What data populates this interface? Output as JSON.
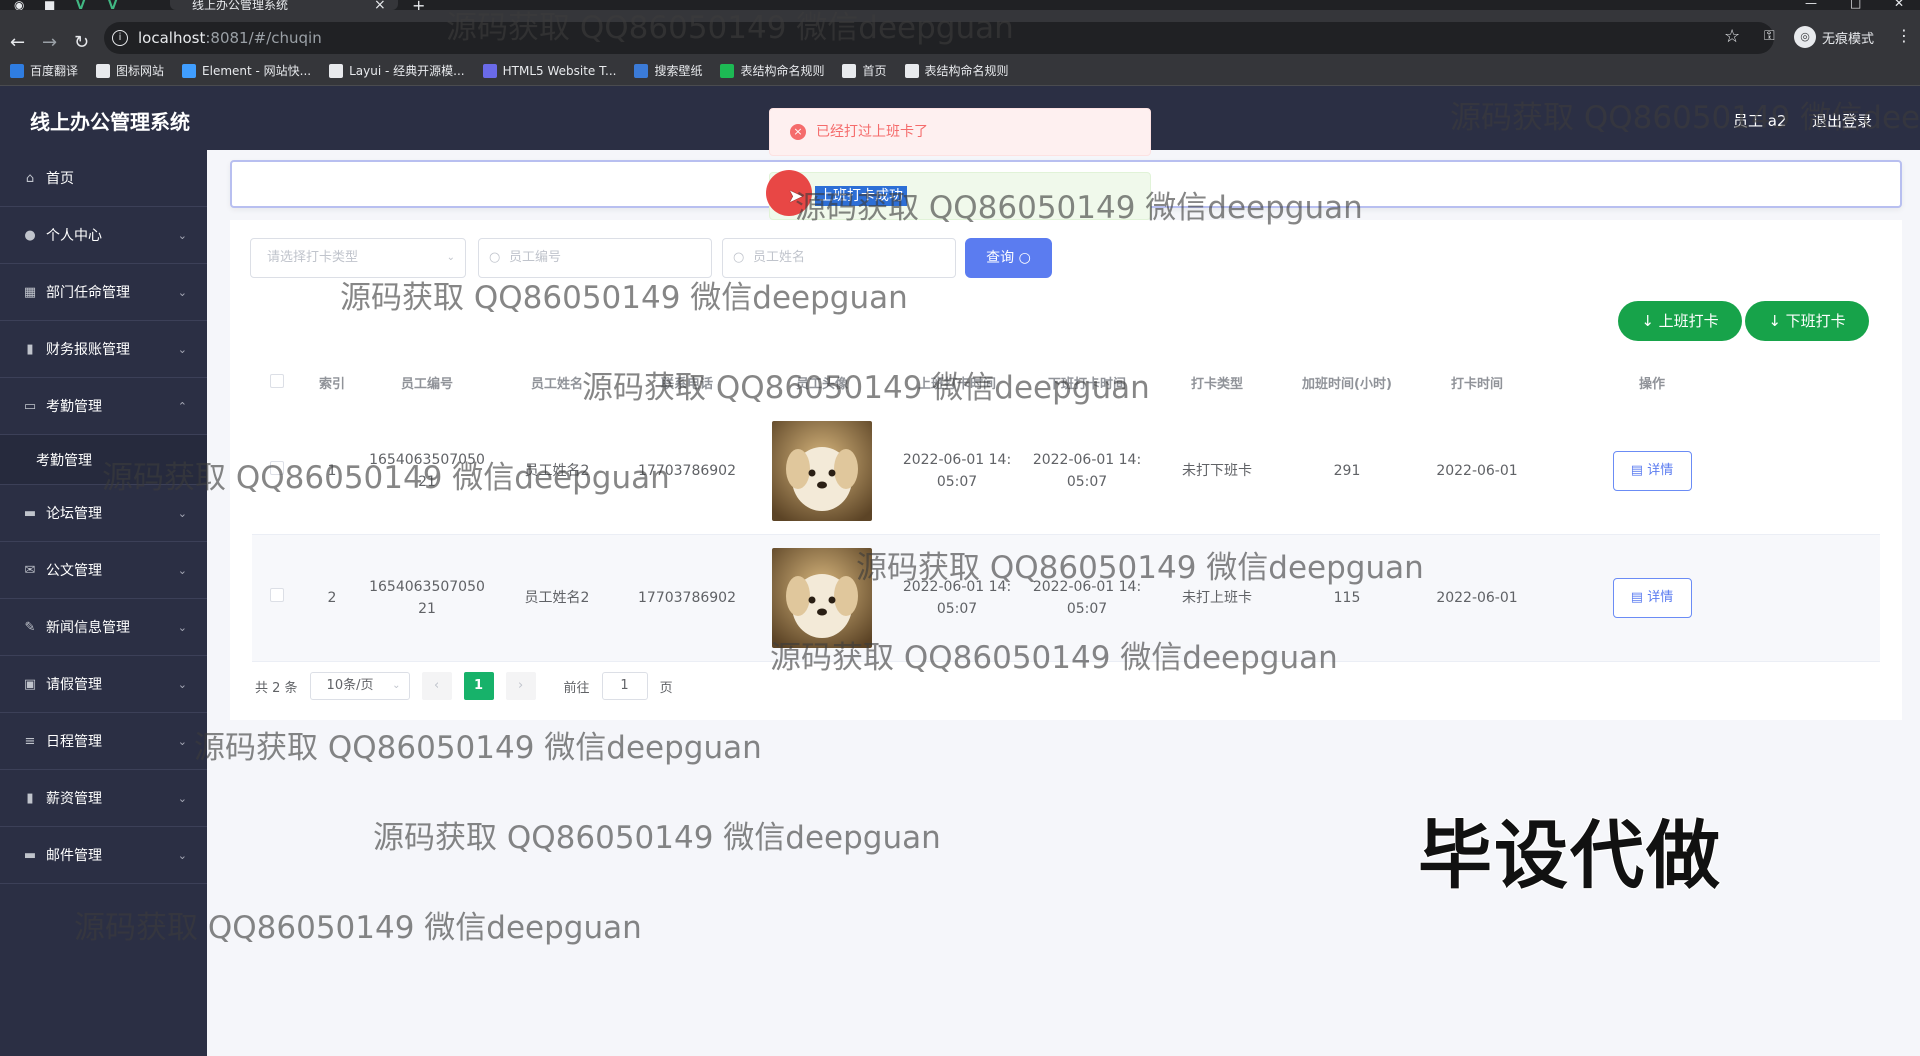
{
  "browser": {
    "tab_title": "线上办公管理系统",
    "url_host": "localhost",
    "url_path": ":8081/#/chuqin",
    "incognito_label": "无痕模式",
    "bookmarks": [
      {
        "label": "百度翻译",
        "color": "#2f7de1"
      },
      {
        "label": "图标网站",
        "color": "#e8eaed"
      },
      {
        "label": "Element - 网站快...",
        "color": "#409eff"
      },
      {
        "label": "Layui - 经典开源模...",
        "color": "#e8eaed"
      },
      {
        "label": "HTML5 Website T...",
        "color": "#6a6ae8"
      },
      {
        "label": "搜索壁纸",
        "color": "#3b7bd8"
      },
      {
        "label": "表结构命名规则",
        "color": "#1db954"
      },
      {
        "label": "首页",
        "color": "#e8eaed"
      },
      {
        "label": "表结构命名规则",
        "color": "#e8eaed"
      }
    ]
  },
  "header": {
    "app_title": "线上办公管理系统",
    "user": "员工 a2",
    "logout": "退出登录"
  },
  "sidebar": {
    "items": [
      {
        "label": "首页",
        "icon": "home-icon",
        "glyph": "⌂",
        "chevron": false
      },
      {
        "label": "个人中心",
        "icon": "user-icon",
        "glyph": "●",
        "chevron": true
      },
      {
        "label": "部门任命管理",
        "icon": "grid-icon",
        "glyph": "▦",
        "chevron": true
      },
      {
        "label": "财务报账管理",
        "icon": "bar-chart-icon",
        "glyph": "▮",
        "chevron": true
      },
      {
        "label": "考勤管理",
        "icon": "comment-icon",
        "glyph": "▭",
        "chevron": true,
        "expanded": true
      },
      {
        "label": "论坛管理",
        "icon": "forum-icon",
        "glyph": "▬",
        "chevron": true
      },
      {
        "label": "公文管理",
        "icon": "mail-icon",
        "glyph": "✉",
        "chevron": true
      },
      {
        "label": "新闻信息管理",
        "icon": "edit-icon",
        "glyph": "✎",
        "chevron": true
      },
      {
        "label": "请假管理",
        "icon": "calendar-icon",
        "glyph": "▣",
        "chevron": true
      },
      {
        "label": "日程管理",
        "icon": "list-icon",
        "glyph": "≡",
        "chevron": true
      },
      {
        "label": "薪资管理",
        "icon": "chart-icon",
        "glyph": "▮",
        "chevron": true
      },
      {
        "label": "邮件管理",
        "icon": "monitor-icon",
        "glyph": "▬",
        "chevron": true
      }
    ],
    "sub_item": "考勤管理"
  },
  "filters": {
    "type_placeholder": "请选择打卡类型",
    "emp_no_placeholder": "员工编号",
    "emp_name_placeholder": "员工姓名",
    "query_label": "查询"
  },
  "actions": {
    "clock_in": "上班打卡",
    "clock_out": "下班打卡"
  },
  "table": {
    "columns": [
      "索引",
      "员工编号",
      "员工姓名",
      "联系电话",
      "员工头像",
      "上班打卡时间",
      "下班打卡时间",
      "打卡类型",
      "加班时间(小时)",
      "打卡时间",
      "操作"
    ],
    "rows": [
      {
        "index": "1",
        "emp_no": "1654063507050 21",
        "emp_name": "员工姓名2",
        "phone": "17703786902",
        "in_time": "2022-06-01 14: 05:07",
        "out_time": "2022-06-01 14: 05:07",
        "type": "未打下班卡",
        "overtime": "291",
        "date": "2022-06-01",
        "action": "详情"
      },
      {
        "index": "2",
        "emp_no": "1654063507050 21",
        "emp_name": "员工姓名2",
        "phone": "17703786902",
        "in_time": "2022-06-01 14: 05:07",
        "out_time": "2022-06-01 14: 05:07",
        "type": "未打上班卡",
        "overtime": "115",
        "date": "2022-06-01",
        "action": "详情"
      }
    ]
  },
  "pager": {
    "total": "共 2 条",
    "size": "10条/页",
    "current": "1",
    "goto_label": "前往",
    "goto_value": "1",
    "page_label": "页"
  },
  "toasts": {
    "error": "已经打过上班卡了",
    "success": "上班打卡成功"
  },
  "watermark": {
    "text": "源码获取 QQ86050149 微信deepguan",
    "big": "毕设代做"
  }
}
